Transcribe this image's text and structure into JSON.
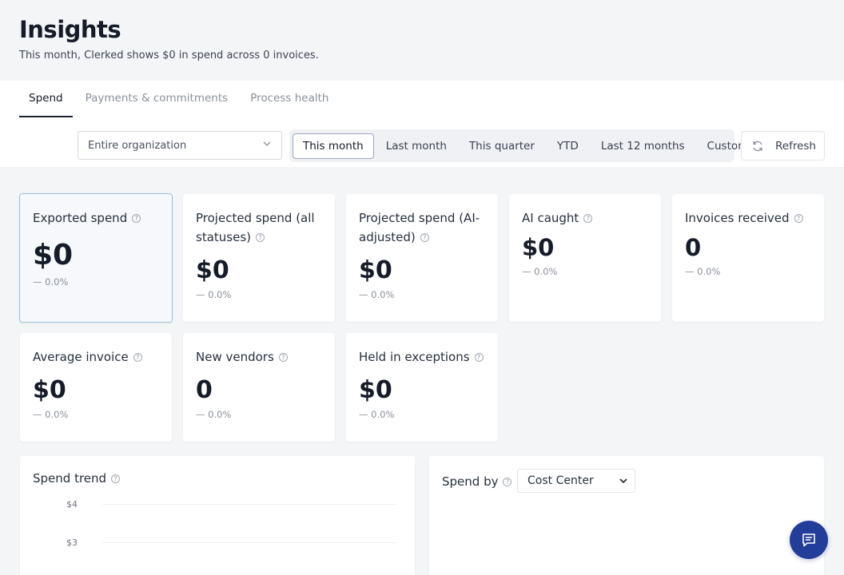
{
  "header": {
    "title": "Insights",
    "subtitle": "This month, Clerked shows $0 in spend across 0 invoices."
  },
  "tabs": [
    {
      "label": "Spend",
      "active": true
    },
    {
      "label": "Payments & commitments",
      "active": false
    },
    {
      "label": "Process health",
      "active": false
    }
  ],
  "filters": {
    "scope_value": "Entire organization",
    "periods": [
      {
        "label": "This month",
        "active": true
      },
      {
        "label": "Last month",
        "active": false
      },
      {
        "label": "This quarter",
        "active": false
      },
      {
        "label": "YTD",
        "active": false
      },
      {
        "label": "Last 12 months",
        "active": false
      },
      {
        "label": "Custom",
        "active": false
      }
    ],
    "refresh_label": "Refresh"
  },
  "metrics": [
    {
      "label": "Exported spend",
      "value": "$0",
      "delta": "— 0.0%"
    },
    {
      "label": "Projected spend (all statuses)",
      "value": "$0",
      "delta": "— 0.0%"
    },
    {
      "label": "Projected spend (AI-adjusted)",
      "value": "$0",
      "delta": "— 0.0%"
    },
    {
      "label": "AI caught",
      "value": "$0",
      "delta": "— 0.0%"
    },
    {
      "label": "Invoices received",
      "value": "0",
      "delta": "— 0.0%"
    },
    {
      "label": "Average invoice",
      "value": "$0",
      "delta": "— 0.0%"
    },
    {
      "label": "New vendors",
      "value": "0",
      "delta": "— 0.0%"
    },
    {
      "label": "Held in exceptions",
      "value": "$0",
      "delta": "— 0.0%"
    }
  ],
  "spend_trend": {
    "title": "Spend trend",
    "y_ticks": [
      "$4",
      "$3"
    ]
  },
  "spend_by": {
    "title": "Spend by",
    "selected": "Cost Center"
  },
  "help_glyph": "?",
  "colors": {
    "accent": "#233e9a",
    "active_border": "#9aa4c8",
    "highlight_border": "#9cc0dd"
  }
}
